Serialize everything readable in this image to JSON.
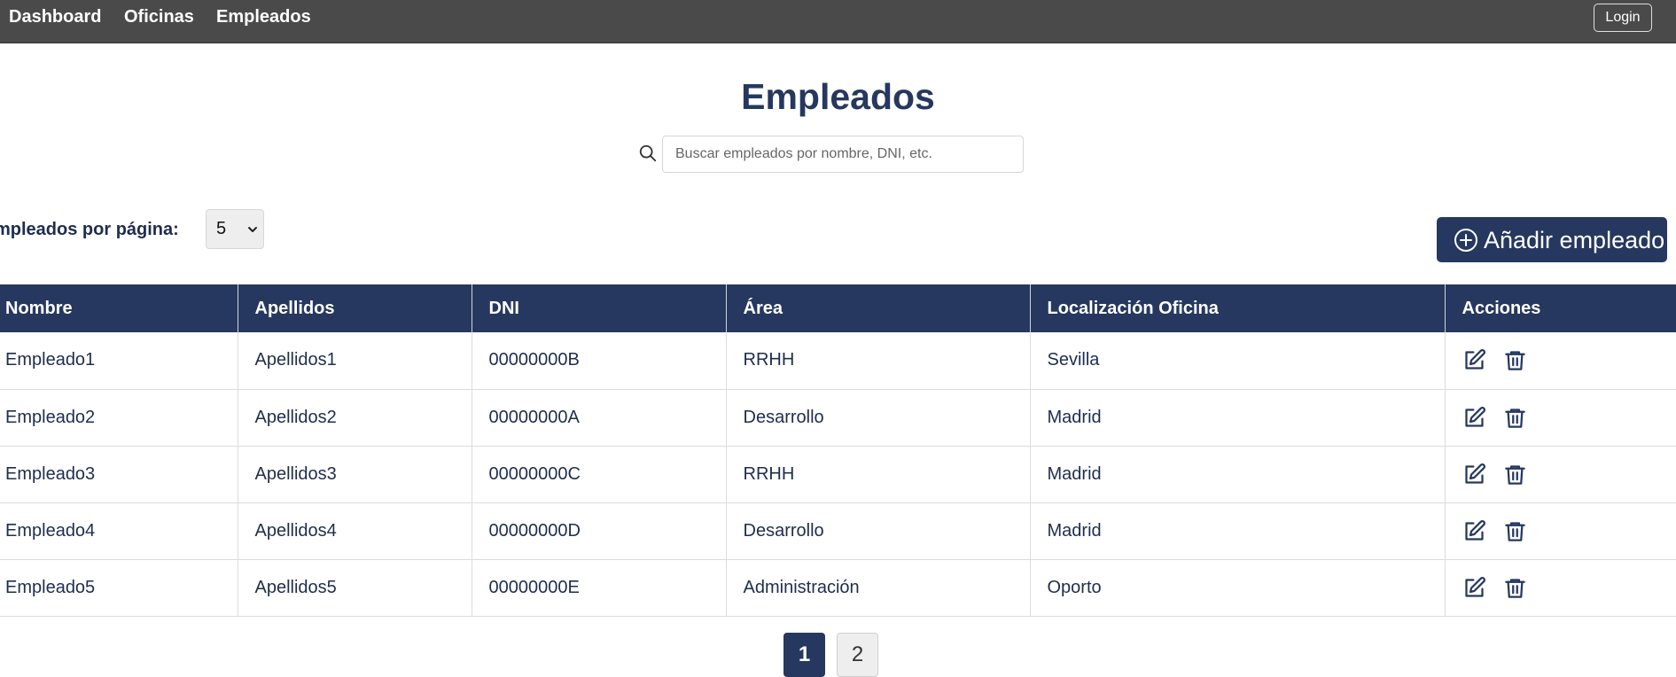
{
  "nav": {
    "links": [
      "Dashboard",
      "Oficinas",
      "Empleados"
    ],
    "login_label": "Login"
  },
  "page": {
    "title": "Empleados"
  },
  "search": {
    "placeholder": "Buscar empleados por nombre, DNI, etc.",
    "value": "",
    "icon": "search-icon"
  },
  "perpage": {
    "label": "mpleados por página:",
    "selected": "5"
  },
  "add_button": {
    "label": "Añadir empleado",
    "icon": "plus-circle-icon"
  },
  "table": {
    "headers": [
      "Nombre",
      "Apellidos",
      "DNI",
      "Área",
      "Localización Oficina",
      "Acciones"
    ],
    "rows": [
      {
        "nombre": "Empleado1",
        "apellidos": "Apellidos1",
        "dni": "00000000B",
        "area": "RRHH",
        "localizacion": "Sevilla"
      },
      {
        "nombre": "Empleado2",
        "apellidos": "Apellidos2",
        "dni": "00000000A",
        "area": "Desarrollo",
        "localizacion": "Madrid"
      },
      {
        "nombre": "Empleado3",
        "apellidos": "Apellidos3",
        "dni": "00000000C",
        "area": "RRHH",
        "localizacion": "Madrid"
      },
      {
        "nombre": "Empleado4",
        "apellidos": "Apellidos4",
        "dni": "00000000D",
        "area": "Desarrollo",
        "localizacion": "Madrid"
      },
      {
        "nombre": "Empleado5",
        "apellidos": "Apellidos5",
        "dni": "00000000E",
        "area": "Administración",
        "localizacion": "Oporto"
      }
    ],
    "action_icons": [
      "edit-icon",
      "trash-icon"
    ]
  },
  "pagination": {
    "pages": [
      "1",
      "2"
    ],
    "current": "1"
  },
  "colors": {
    "navbar": "#4a4a4a",
    "primary": "#26385f"
  }
}
